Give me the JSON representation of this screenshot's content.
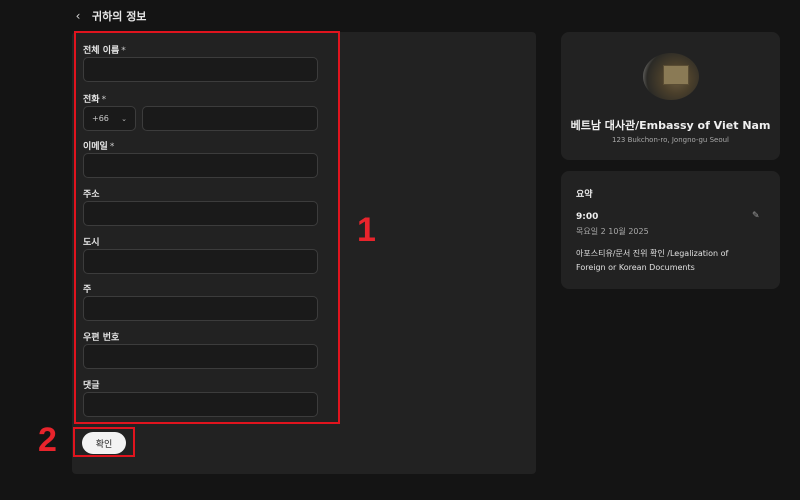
{
  "header": {
    "back_icon": "chevron-left-icon",
    "title": "귀하의 정보"
  },
  "form": {
    "required_marker": "*",
    "full_name": {
      "label": "전체 이름",
      "value": "",
      "required": true
    },
    "phone": {
      "label": "전화",
      "country_code": "+66",
      "value": "",
      "required": true
    },
    "email": {
      "label": "이메일",
      "value": "",
      "required": true
    },
    "address": {
      "label": "주소",
      "value": ""
    },
    "city": {
      "label": "도시",
      "value": ""
    },
    "state": {
      "label": "주",
      "value": ""
    },
    "postal_code": {
      "label": "우편 번호",
      "value": ""
    },
    "comment": {
      "label": "댓글",
      "value": ""
    },
    "confirm_label": "확인"
  },
  "annotations": {
    "callout_1": "1",
    "callout_2": "2",
    "highlight_color": "#e0141e"
  },
  "embassy": {
    "name": "베트남 대사관/Embassy of Viet Nam",
    "address": "123 Bukchon-ro, Jongno-gu Seoul"
  },
  "summary": {
    "title": "요약",
    "time": "9:00",
    "date": "목요일 2 10월 2025",
    "service": "아포스티유/문서 진위 확인 /Legalization of Foreign or Korean Documents",
    "edit_icon": "pencil-icon"
  },
  "colors": {
    "background": "#141414",
    "panel": "#222222",
    "button_bg": "#f3f3f3"
  }
}
